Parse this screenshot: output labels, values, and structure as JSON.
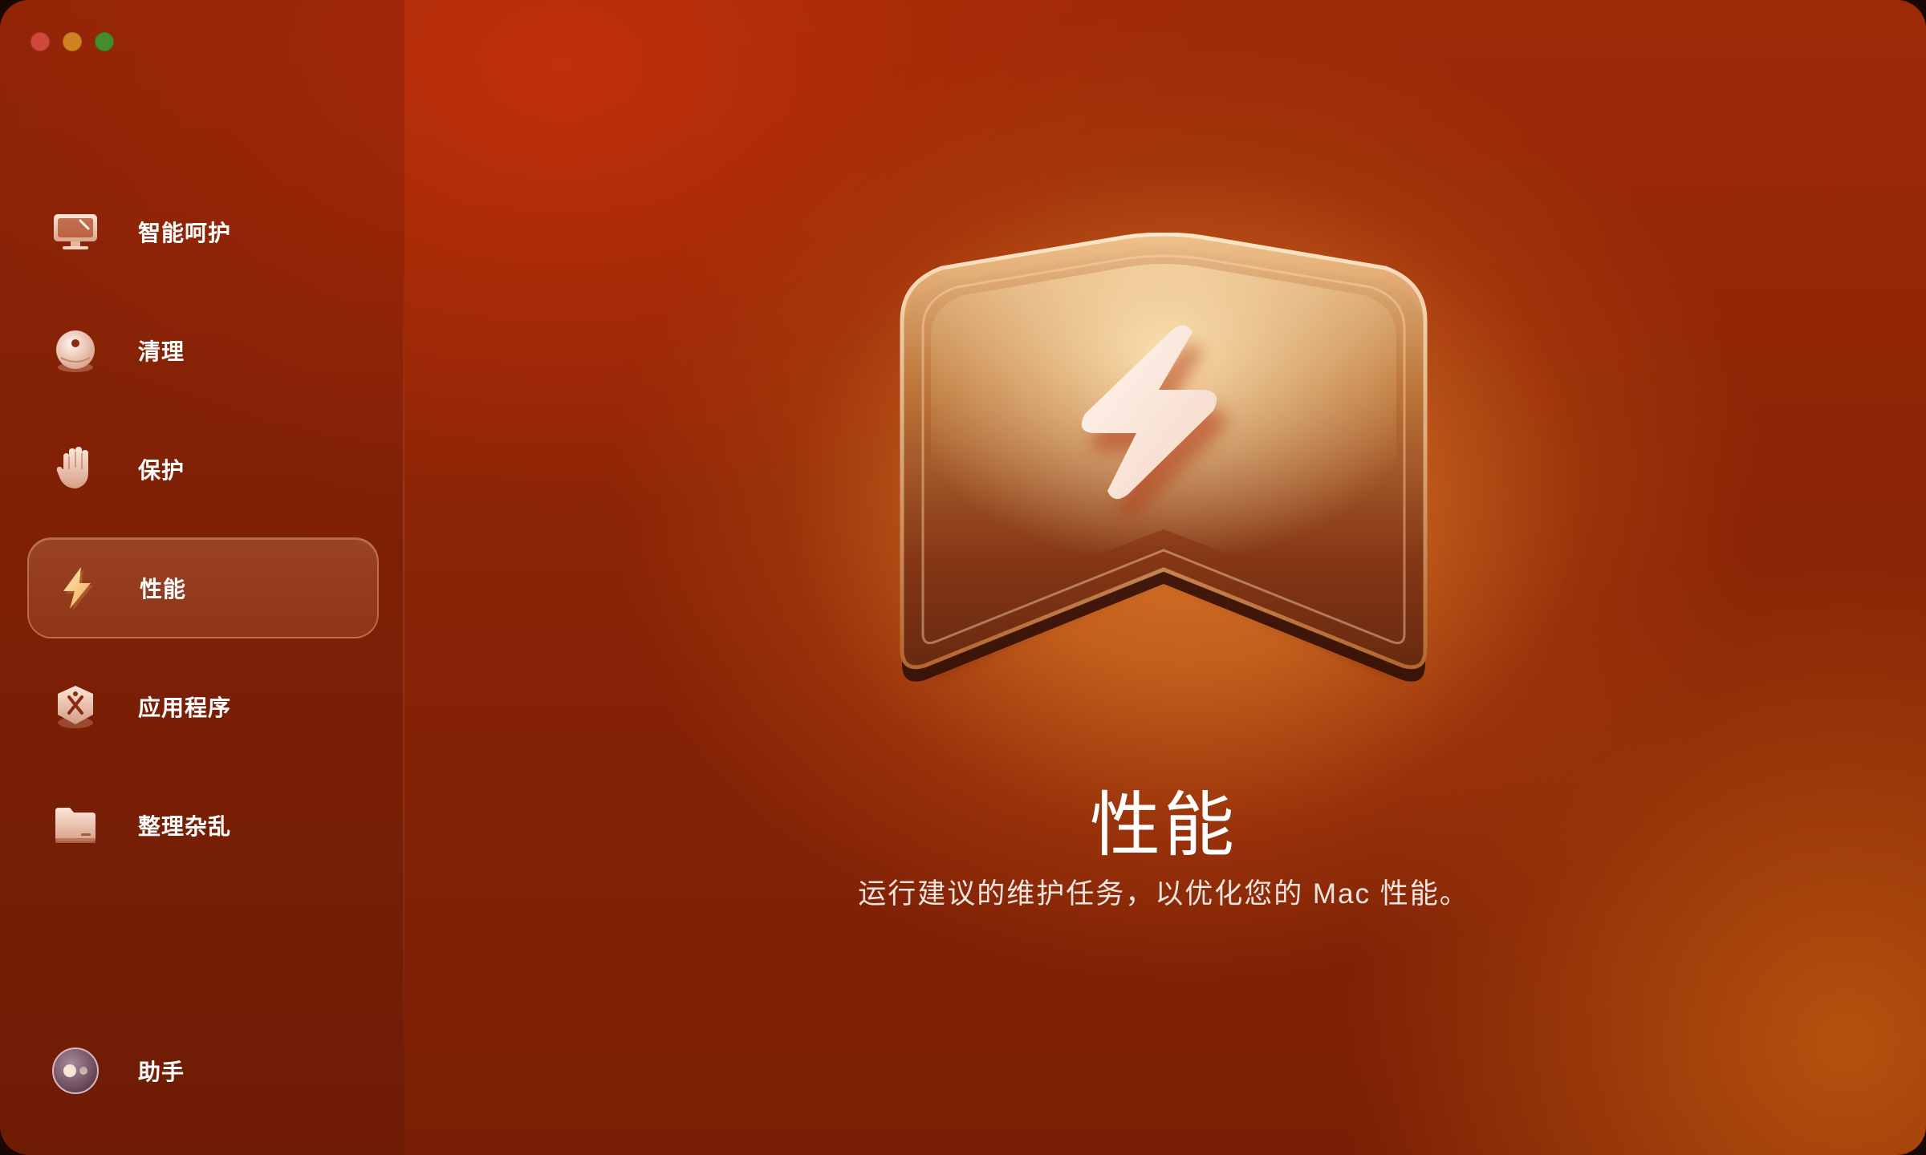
{
  "window": {
    "controls": [
      "close",
      "minimize",
      "maximize"
    ]
  },
  "sidebar": {
    "items": [
      {
        "label": "智能呵护",
        "icon": "monitor-icon",
        "active": false
      },
      {
        "label": "清理",
        "icon": "cleaner-icon",
        "active": false
      },
      {
        "label": "保护",
        "icon": "hand-icon",
        "active": false
      },
      {
        "label": "性能",
        "icon": "lightning-icon",
        "active": true
      },
      {
        "label": "应用程序",
        "icon": "apps-icon",
        "active": false
      },
      {
        "label": "整理杂乱",
        "icon": "folder-icon",
        "active": false
      }
    ],
    "assistant": {
      "label": "助手",
      "icon": "assistant-icon"
    }
  },
  "main": {
    "title": "性能",
    "subtitle": "运行建议的维护任务，以优化您的 Mac 性能。",
    "hero_icon": "lightning-shield-icon"
  },
  "colors": {
    "accent": "#c9561b",
    "background_dark": "#7a1f05",
    "active_item_border": "#ffc8aa"
  }
}
